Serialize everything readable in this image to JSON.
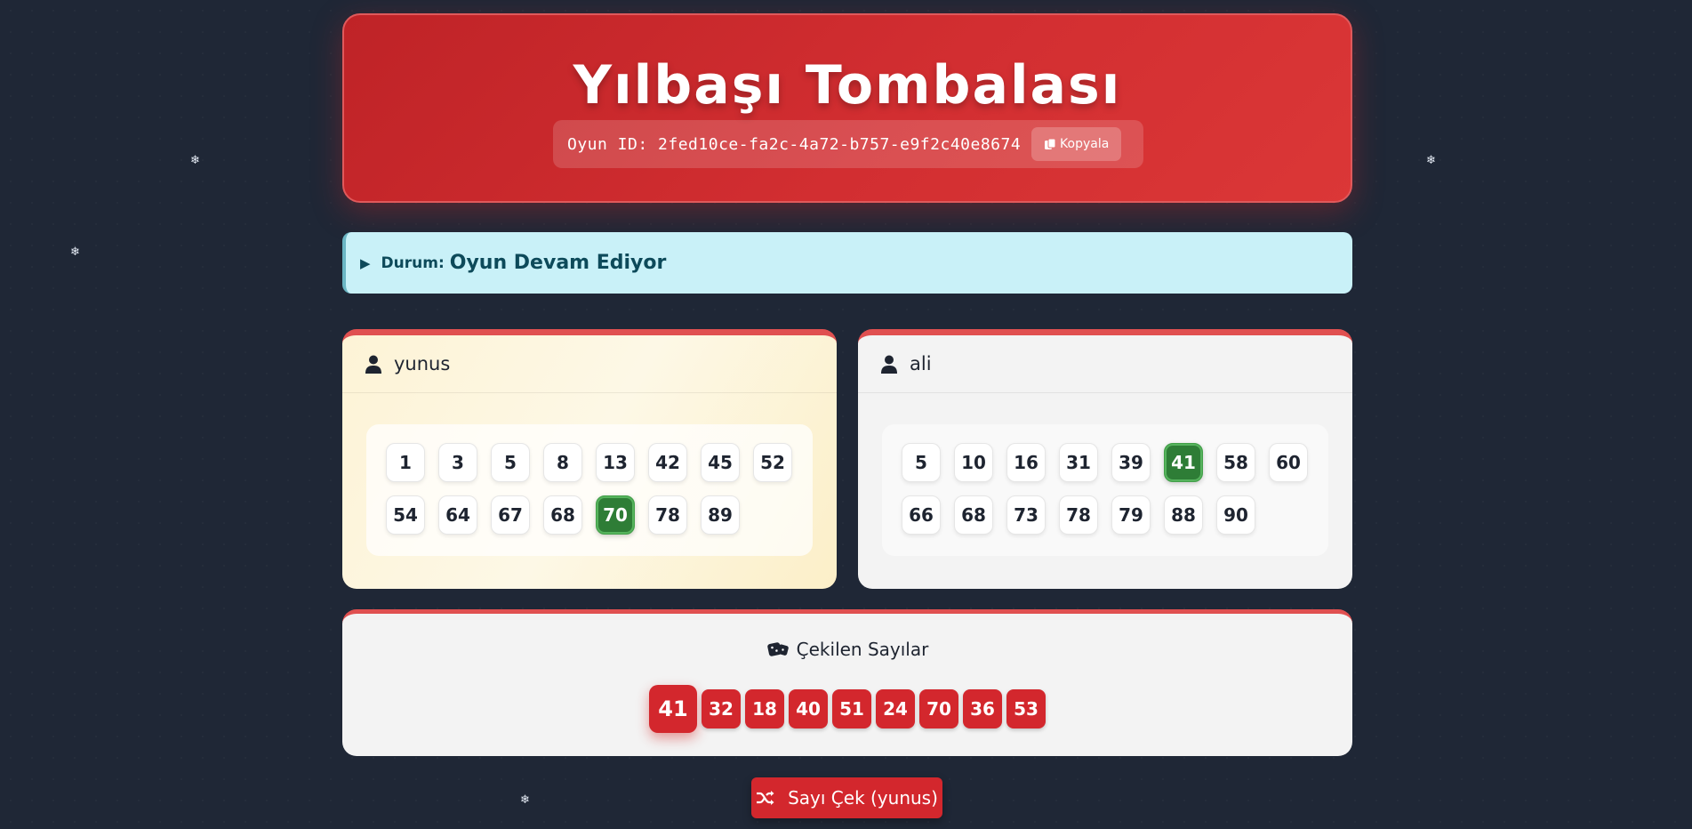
{
  "header": {
    "title": "Yılbaşı Tombalası",
    "game_id_label": "Oyun ID:",
    "game_id": "2fed10ce-fa2c-4a72-b757-e9f2c40e8674",
    "copy_label": "Kopyala"
  },
  "status": {
    "label": "Durum:",
    "value": "Oyun Devam Ediyor"
  },
  "players": [
    {
      "name": "yunus",
      "card_numbers": [
        1,
        3,
        5,
        8,
        13,
        42,
        45,
        52,
        54,
        64,
        67,
        68,
        70,
        78,
        89
      ],
      "marked": [
        70
      ]
    },
    {
      "name": "ali",
      "card_numbers": [
        5,
        10,
        16,
        31,
        39,
        41,
        58,
        60,
        66,
        68,
        73,
        78,
        79,
        88,
        90
      ],
      "marked": [
        41
      ]
    }
  ],
  "drawn": {
    "title": "Çekilen Sayılar",
    "numbers": [
      41,
      32,
      18,
      40,
      51,
      24,
      70,
      36,
      53
    ]
  },
  "draw_button": {
    "label": "Sayı Çek (yunus)"
  },
  "colors": {
    "accent_red": "#d3272d",
    "marked_green": "#2e7d36",
    "status_bg": "#c9f1f8",
    "page_bg": "#1f2736"
  }
}
